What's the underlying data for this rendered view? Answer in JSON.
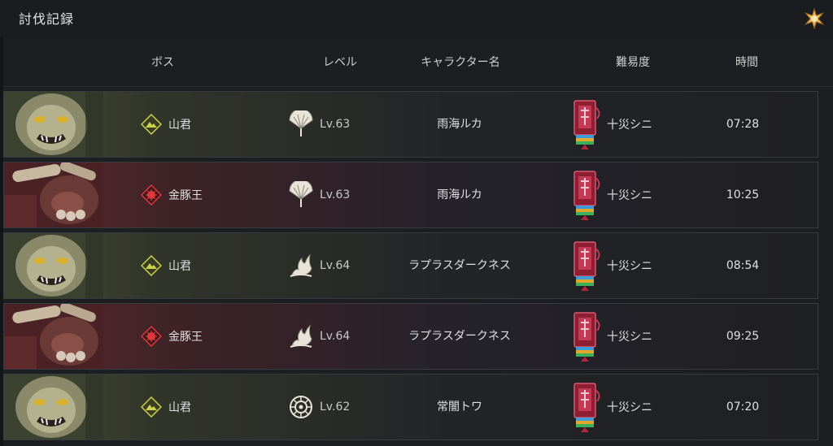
{
  "window": {
    "title": "討伐記録"
  },
  "columns": {
    "boss": "ボス",
    "level": "レベル",
    "character": "キャラクター名",
    "difficulty": "難易度",
    "time": "時間"
  },
  "rows": [
    {
      "boss": "山君",
      "boss_type": "mountain",
      "class_icon": "fan-icon",
      "level": "Lv.63",
      "character": "雨海ルカ",
      "difficulty": "十災シニ",
      "time": "07:28"
    },
    {
      "boss": "金豚王",
      "boss_type": "pig",
      "class_icon": "fan-icon",
      "level": "Lv.63",
      "character": "雨海ルカ",
      "difficulty": "十災シニ",
      "time": "10:25"
    },
    {
      "boss": "山君",
      "boss_type": "mountain",
      "class_icon": "flame-icon",
      "level": "Lv.64",
      "character": "ラプラスダークネス",
      "difficulty": "十災シニ",
      "time": "08:54"
    },
    {
      "boss": "金豚王",
      "boss_type": "pig",
      "class_icon": "flame-icon",
      "level": "Lv.64",
      "character": "ラプラスダークネス",
      "difficulty": "十災シニ",
      "time": "09:25"
    },
    {
      "boss": "山君",
      "boss_type": "mountain",
      "class_icon": "rose-emblem-icon",
      "level": "Lv.62",
      "character": "常闇トワ",
      "difficulty": "十災シニ",
      "time": "07:20"
    }
  ],
  "colors": {
    "mountain_accent": "#c8d24a",
    "pig_accent": "#e0383c",
    "difficulty_red": "#b3273a"
  }
}
